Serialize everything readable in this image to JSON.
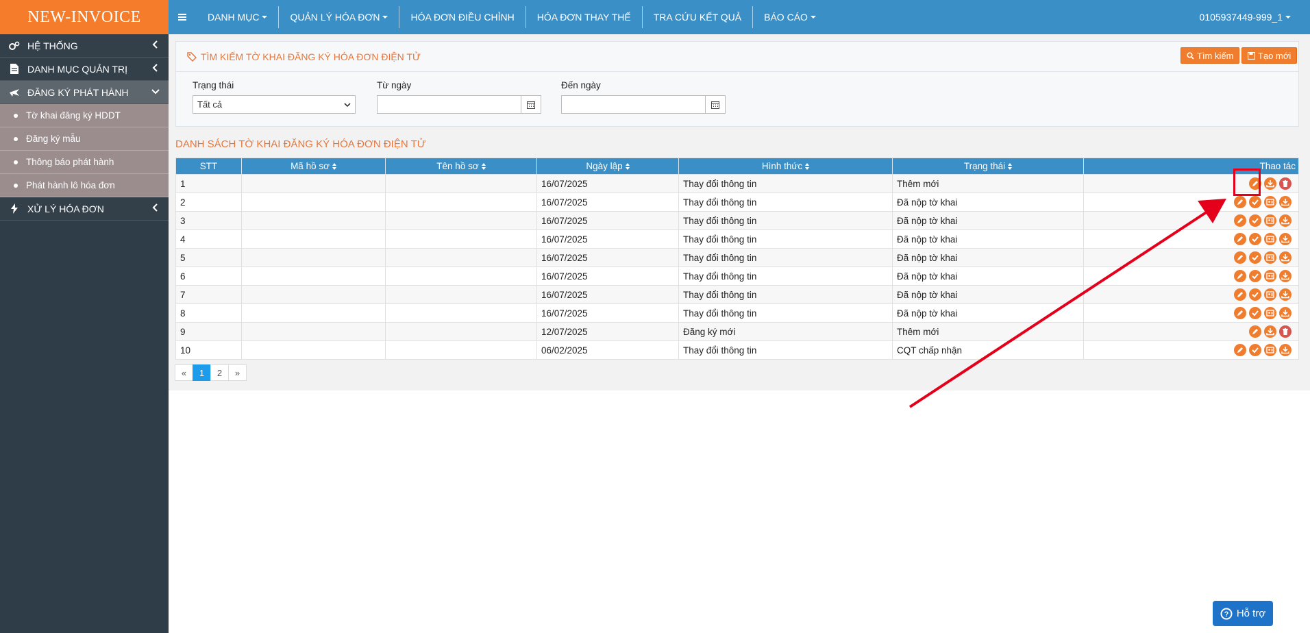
{
  "brand": "NEW-INVOICE",
  "sidebar": {
    "items": [
      {
        "label": "HỆ THỐNG",
        "icon": "cogs-icon"
      },
      {
        "label": "DANH MỤC QUẢN TRỊ",
        "icon": "file-icon"
      },
      {
        "label": "ĐĂNG KÝ PHÁT HÀNH",
        "icon": "plane-icon"
      },
      {
        "label": "XỬ LÝ HÓA ĐƠN",
        "icon": "bolt-icon"
      }
    ],
    "subitems": [
      "Tờ khai đăng ký HDDT",
      "Đăng ký mẫu",
      "Thông báo phát hành",
      "Phát hành lô hóa đơn"
    ]
  },
  "topnav": {
    "items": [
      "DANH MỤC",
      "QUẢN LÝ HÓA ĐƠN",
      "HÓA ĐƠN ĐIỀU CHỈNH",
      "HÓA ĐƠN THAY THẾ",
      "TRA CỨU KẾT QUẢ",
      "BÁO CÁO"
    ],
    "account": "0105937449-999_1"
  },
  "search": {
    "title": "TÌM KIẾM TỜ KHAI ĐĂNG KÝ HÓA ĐƠN ĐIỆN TỬ",
    "search_btn": "Tìm kiếm",
    "create_btn": "Tạo mới",
    "status_label": "Trạng thái",
    "status_value": "Tất cả",
    "from_label": "Từ ngày",
    "to_label": "Đến ngày"
  },
  "list": {
    "title": "DANH SÁCH TỜ KHAI ĐĂNG KÝ HÓA ĐƠN ĐIỆN TỬ",
    "headers": [
      "STT",
      "Mã hồ sơ",
      "Tên hồ sơ",
      "Ngày lập",
      "Hình thức",
      "Trạng thái",
      "Thao tác"
    ],
    "rows": [
      {
        "stt": "1",
        "ngay": "16/07/2025",
        "hinhthuc": "Thay đổi thông tin",
        "trangthai": "Thêm mới"
      },
      {
        "stt": "2",
        "ngay": "16/07/2025",
        "hinhthuc": "Thay đổi thông tin",
        "trangthai": "Đã nộp tờ khai"
      },
      {
        "stt": "3",
        "ngay": "16/07/2025",
        "hinhthuc": "Thay đổi thông tin",
        "trangthai": "Đã nộp tờ khai"
      },
      {
        "stt": "4",
        "ngay": "16/07/2025",
        "hinhthuc": "Thay đổi thông tin",
        "trangthai": "Đã nộp tờ khai"
      },
      {
        "stt": "5",
        "ngay": "16/07/2025",
        "hinhthuc": "Thay đổi thông tin",
        "trangthai": "Đã nộp tờ khai"
      },
      {
        "stt": "6",
        "ngay": "16/07/2025",
        "hinhthuc": "Thay đổi thông tin",
        "trangthai": "Đã nộp tờ khai"
      },
      {
        "stt": "7",
        "ngay": "16/07/2025",
        "hinhthuc": "Thay đổi thông tin",
        "trangthai": "Đã nộp tờ khai"
      },
      {
        "stt": "8",
        "ngay": "16/07/2025",
        "hinhthuc": "Thay đổi thông tin",
        "trangthai": "Đã nộp tờ khai"
      },
      {
        "stt": "9",
        "ngay": "12/07/2025",
        "hinhthuc": "Đăng ký mới",
        "trangthai": "Thêm mới"
      },
      {
        "stt": "10",
        "ngay": "06/02/2025",
        "hinhthuc": "Thay đổi thông tin",
        "trangthai": "CQT chấp nhận"
      }
    ]
  },
  "pager": {
    "prev": "«",
    "pages": [
      "1",
      "2"
    ],
    "next": "»"
  },
  "help": "Hỗ trợ",
  "colors": {
    "brand": "#f47c2a",
    "nav": "#3a8fc7",
    "accent": "#f07d2e",
    "annotation": "#e4001b"
  }
}
